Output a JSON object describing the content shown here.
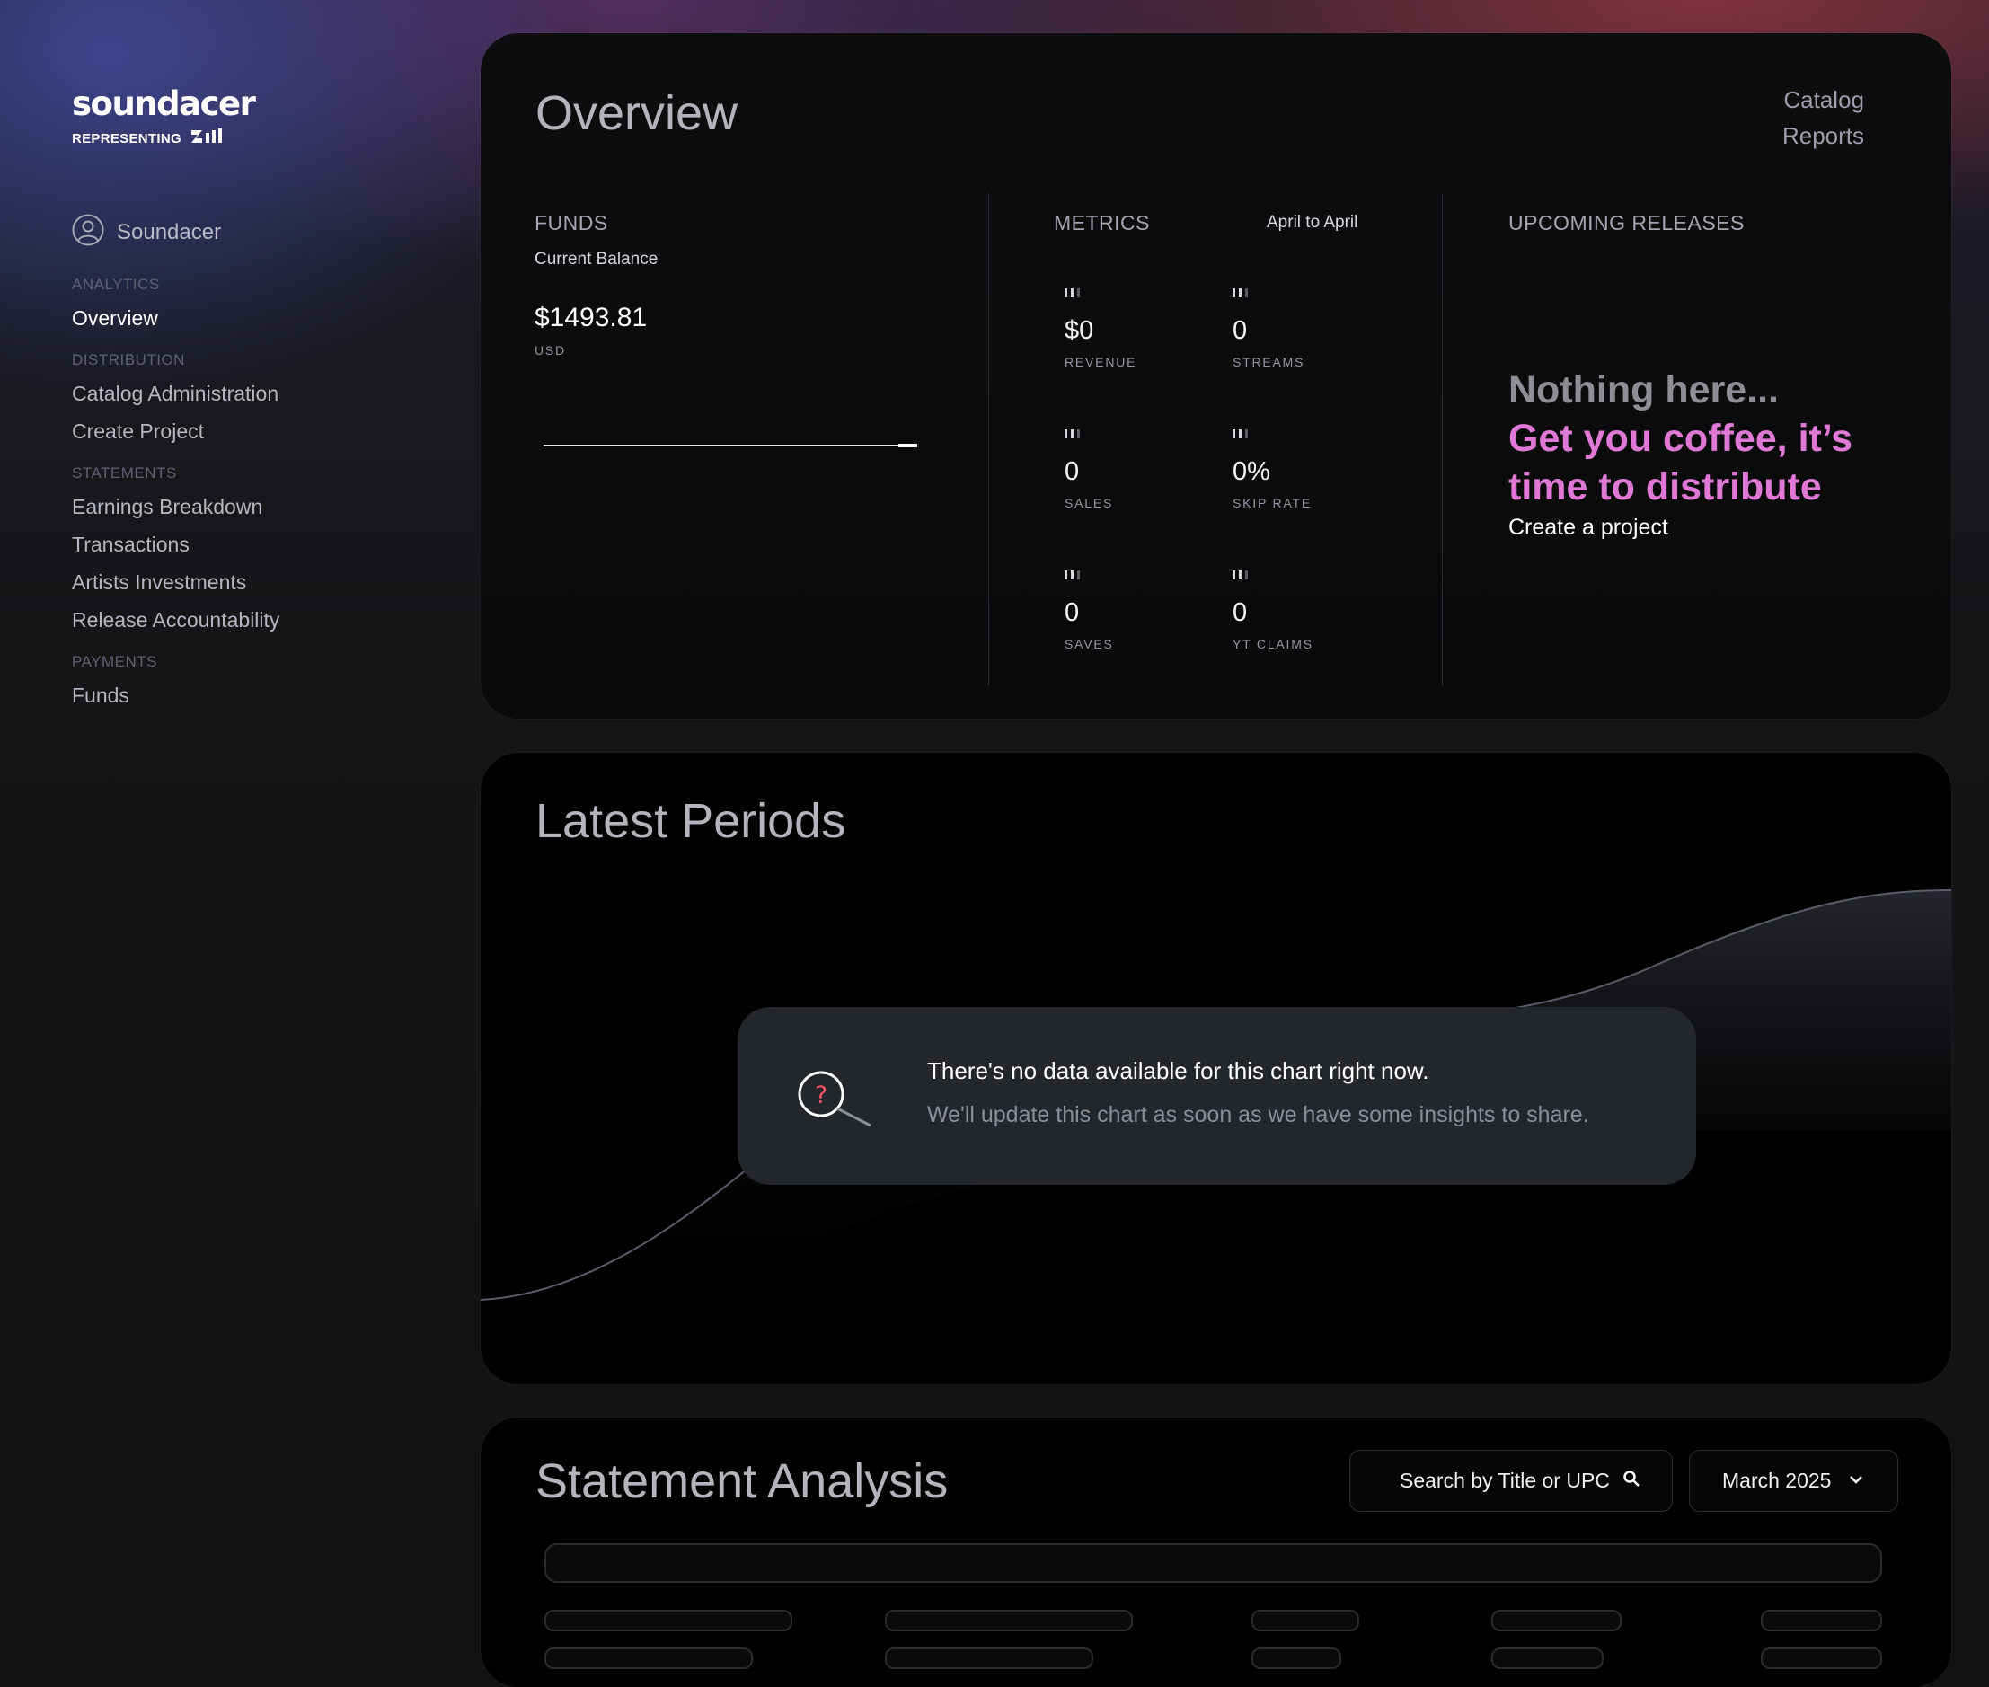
{
  "brand": {
    "name": "soundacer",
    "representing": "REPRESENTING"
  },
  "sidebar": {
    "user": "Soundacer",
    "sections": [
      {
        "title": "ANALYTICS",
        "items": [
          "Overview"
        ]
      },
      {
        "title": "DISTRIBUTION",
        "items": [
          "Catalog Administration",
          "Create Project"
        ]
      },
      {
        "title": "STATEMENTS",
        "items": [
          "Earnings Breakdown",
          "Transactions",
          "Artists Investments",
          "Release Accountability"
        ]
      },
      {
        "title": "PAYMENTS",
        "items": [
          "Funds"
        ]
      }
    ],
    "active_item": "Overview"
  },
  "overview": {
    "title": "Overview",
    "links": [
      "Catalog",
      "Reports"
    ],
    "funds": {
      "label": "FUNDS",
      "sublabel": "Current Balance",
      "amount": "$1493.81",
      "currency": "USD"
    },
    "metrics": {
      "label": "METRICS",
      "range": "April to April",
      "items": [
        {
          "value": "$0",
          "caption": "REVENUE"
        },
        {
          "value": "0",
          "caption": "STREAMS"
        },
        {
          "value": "0",
          "caption": "SALES"
        },
        {
          "value": "0%",
          "caption": "SKIP RATE"
        },
        {
          "value": "0",
          "caption": "SAVES"
        },
        {
          "value": "0",
          "caption": "YT CLAIMS"
        }
      ]
    },
    "upcoming": {
      "label": "UPCOMING RELEASES",
      "empty_title": "Nothing here...",
      "empty_line1": "Get you coffee, it’s",
      "empty_line2": "time to distribute",
      "cta": "Create a project"
    }
  },
  "periods": {
    "title": "Latest Periods",
    "empty_heading": "There's no data available for this chart right now.",
    "empty_body": "We'll update this chart as soon as we have some insights to share."
  },
  "statement": {
    "title": "Statement Analysis",
    "search_placeholder": "Search by Title or UPC",
    "month": "March 2025"
  },
  "colors": {
    "accent_pink": "#e079d6",
    "background": "#121212",
    "card": "#0b0b0c"
  }
}
